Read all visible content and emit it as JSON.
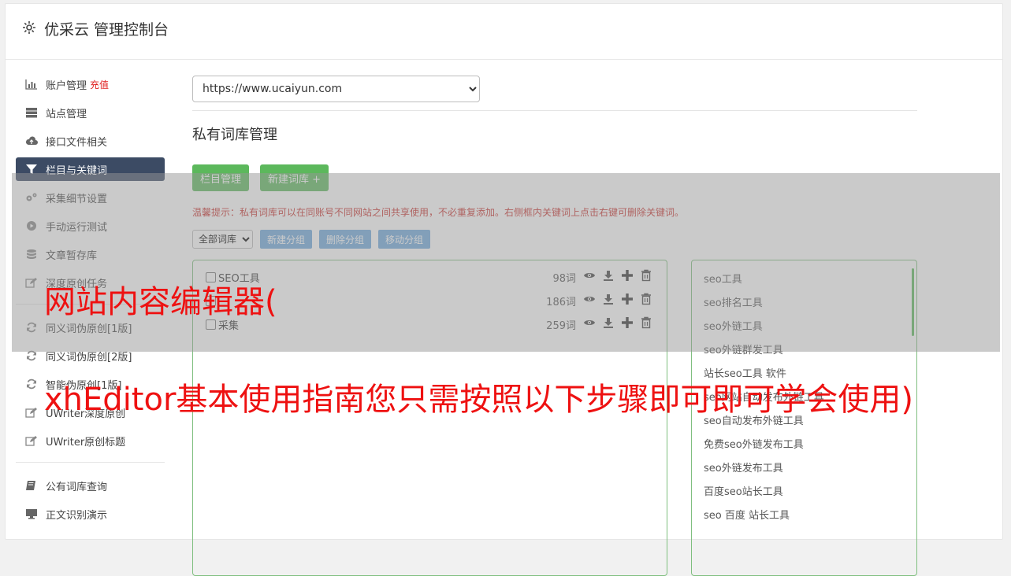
{
  "app": {
    "title": "优采云 管理控制台"
  },
  "sidebar": {
    "items": [
      {
        "icon": "bar-chart-icon",
        "label": "账户管理",
        "badge": "充值",
        "active": false
      },
      {
        "icon": "server-icon",
        "label": "站点管理",
        "active": false
      },
      {
        "icon": "cloud-upload-icon",
        "label": "接口文件相关",
        "active": false
      },
      {
        "icon": "filter-icon",
        "label": "栏目与关键词",
        "active": true
      },
      {
        "icon": "cogs-icon",
        "label": "采集细节设置",
        "active": false
      },
      {
        "icon": "play-circle-icon",
        "label": "手动运行测试",
        "active": false
      },
      {
        "icon": "database-icon",
        "label": "文章暂存库",
        "active": false
      },
      {
        "icon": "edit-icon",
        "label": "深度原创任务",
        "active": false
      },
      {
        "icon": "refresh-icon",
        "label": "同义词伪原创[1版]",
        "active": false
      },
      {
        "icon": "refresh-icon",
        "label": "同义词伪原创[2版]",
        "active": false
      },
      {
        "icon": "refresh-icon",
        "label": "智能伪原创[1版]",
        "active": false
      },
      {
        "icon": "edit-icon",
        "label": "UWriter深度原创",
        "active": false
      },
      {
        "icon": "edit-icon",
        "label": "UWriter原创标题",
        "active": false
      },
      {
        "icon": "book-icon",
        "label": "公有词库查询",
        "active": false
      },
      {
        "icon": "monitor-icon",
        "label": "正文识别演示",
        "active": false
      }
    ]
  },
  "main": {
    "site_select": {
      "value": "https://www.ucaiyun.com"
    },
    "section_title": "私有词库管理",
    "buttons": {
      "column_manage": "栏目管理",
      "new_library": "新建词库 +"
    },
    "tip": "温馨提示：私有词库可以在同账号不同网站之间共享使用，不必重复添加。右侧框内关键词上点击右键可删除关键词。",
    "group_filter": {
      "value": "全部词库"
    },
    "group_buttons": {
      "new": "新建分组",
      "delete": "删除分组",
      "move": "移动分组"
    },
    "libraries": [
      {
        "name": "SEO工具",
        "count": "98词"
      },
      {
        "name": "",
        "count": "186词"
      },
      {
        "name": "采集",
        "count": "259词"
      }
    ],
    "keywords": [
      "seo工具",
      "seo排名工具",
      "seo外链工具",
      "seo外链群发工具",
      "站长seo工具 软件",
      "seo网站自动发布外链工具",
      "seo自动发布外链工具",
      "免费seo外链发布工具",
      "seo外链发布工具",
      "百度seo站长工具",
      "seo 百度 站长工具"
    ]
  },
  "overlay": {
    "caption_line1": "网站内容编辑器(",
    "caption_line2": "xhEditor基本使用指南您只需按照以下步骤即可即可学会使用)"
  },
  "colors": {
    "green": "#5cb85c",
    "blue": "#6fa8dc",
    "active_nav": "#3c4b64",
    "caption": "#ee1111",
    "tip": "#c9302c"
  }
}
